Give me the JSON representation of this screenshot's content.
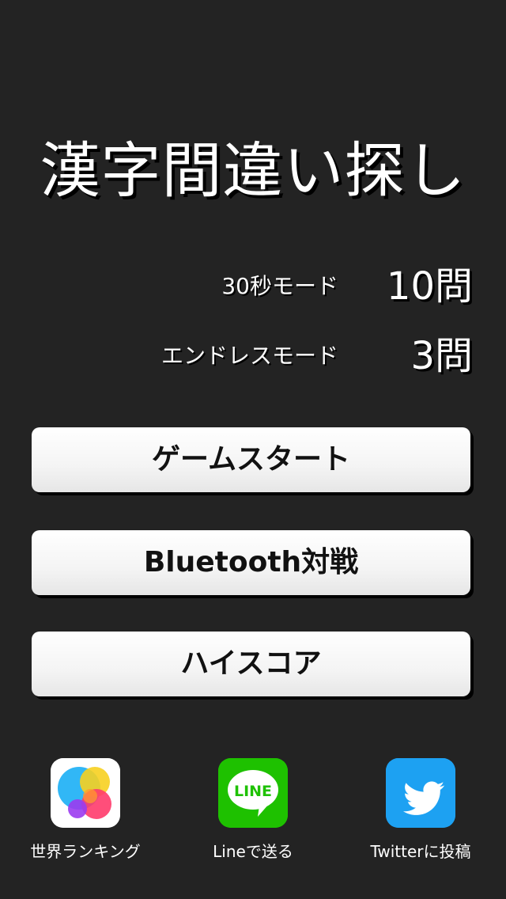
{
  "app": {
    "title": "漢字間違い探し"
  },
  "scores": [
    {
      "mode": "30秒モード",
      "value": "10問"
    },
    {
      "mode": "エンドレスモード",
      "value": "3問"
    }
  ],
  "buttons": {
    "start": "ゲームスタート",
    "bluetooth": "Bluetooth対戦",
    "highscore": "ハイスコア"
  },
  "share": {
    "ranking_label": "世界ランキング",
    "line_label": "Lineで送る",
    "line_logo_text": "LINE",
    "twitter_label": "Twitterに投稿"
  },
  "colors": {
    "background": "#232323",
    "line_green": "#1ec100",
    "twitter_blue": "#1da1f2"
  },
  "icons": {
    "ranking": "game-center-icon",
    "line": "line-icon",
    "twitter": "twitter-bird-icon"
  }
}
